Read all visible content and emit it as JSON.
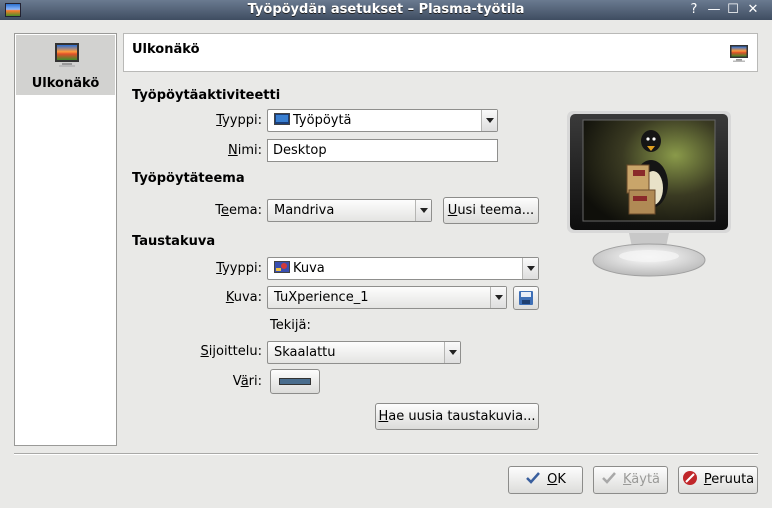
{
  "window": {
    "title": "Työpöydän asetukset – Plasma-työtila",
    "help_glyph": "?",
    "minimize_glyph": "—",
    "maximize_glyph": "☐",
    "close_glyph": "✕"
  },
  "sidebar": {
    "items": [
      {
        "label": "Ulkonäkö",
        "icon": "desktop-appearance-icon",
        "selected": true
      }
    ]
  },
  "header": {
    "title": "Ulkonäkö",
    "icon": "desktop-appearance-icon"
  },
  "activity": {
    "section_title": "Työpöytäaktiviteetti",
    "type_label_u": "T",
    "type_label_rest": "yyppi:",
    "type_value": "Työpöytä",
    "name_label_u": "N",
    "name_label_rest": "imi:",
    "name_value": "Desktop"
  },
  "theme": {
    "section_title": "Työpöytäteema",
    "theme_label_pre": "T",
    "theme_label_u": "e",
    "theme_label_rest": "ema:",
    "theme_value": "Mandriva",
    "new_theme_u": "U",
    "new_theme_rest": "usi teema..."
  },
  "wallpaper": {
    "section_title": "Taustakuva",
    "type_label_u": "T",
    "type_label_rest": "yyppi:",
    "type_value": "Kuva",
    "image_label_u": "K",
    "image_label_rest": "uva:",
    "image_value": "TuXperience_1",
    "author_label": "Tekijä:",
    "position_label_u": "S",
    "position_label_rest": "ijoittelu:",
    "position_value": "Skaalattu",
    "color_label_pre": "V",
    "color_label_u": "ä",
    "color_label_rest": "ri:",
    "color_value": "#4a6d8e",
    "get_new_u": "H",
    "get_new_rest": "ae uusia taustakuvia..."
  },
  "buttons": {
    "ok_u": "O",
    "ok_rest": "K",
    "apply_u": "K",
    "apply_rest": "äytä",
    "cancel_u": "P",
    "cancel_rest": "eruuta"
  },
  "colors": {
    "accent_check": "#3a5f9e",
    "cancel_red": "#c0262a"
  }
}
